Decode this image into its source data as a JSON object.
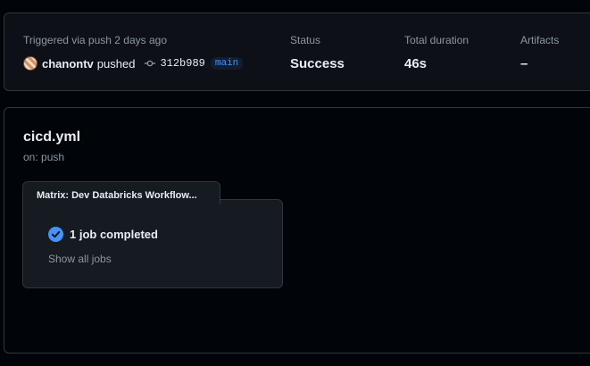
{
  "summary": {
    "trigger_text": "Triggered via push 2 days ago",
    "actor": "chanontv",
    "action": "pushed",
    "commit_sha": "312b989",
    "branch": "main",
    "status_label": "Status",
    "status_value": "Success",
    "duration_label": "Total duration",
    "duration_value": "46s",
    "artifacts_label": "Artifacts",
    "artifacts_value": "–"
  },
  "workflow": {
    "title": "cicd.yml",
    "trigger": "on: push",
    "matrix_title": "Matrix: Dev Databricks Workflow...",
    "job_status": "1 job completed",
    "show_jobs_label": "Show all jobs"
  },
  "icons": {
    "commit": "git-commit-icon",
    "check": "check-circle-icon",
    "avatar": "user-avatar"
  },
  "colors": {
    "accent_blue": "#4493f8",
    "success_check": "#4493f8",
    "background": "#010409",
    "card": "#0d1117"
  }
}
